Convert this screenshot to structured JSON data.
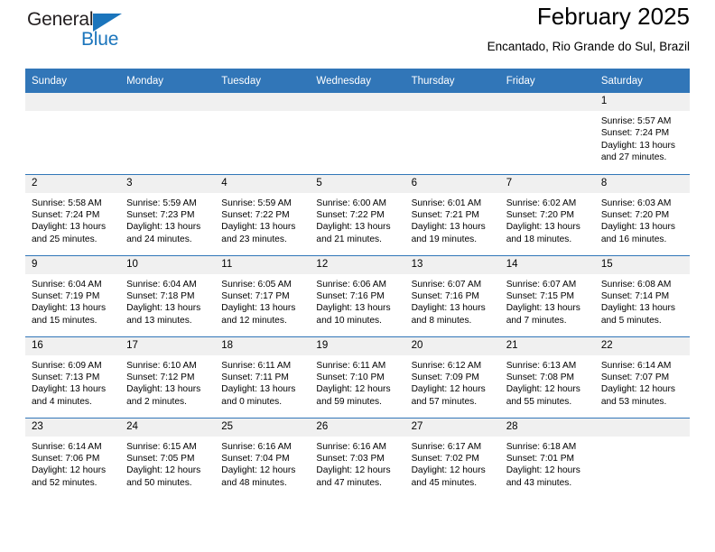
{
  "brand": {
    "name_part1": "General",
    "name_part2": "Blue",
    "triangle_icon": "triangle-icon",
    "accent_color": "#1b75bc"
  },
  "header": {
    "title": "February 2025",
    "subtitle": "Encantado, Rio Grande do Sul, Brazil",
    "header_bg_color": "#3176b8",
    "daynum_bg_color": "#f0f0f0"
  },
  "weekdays": [
    "Sunday",
    "Monday",
    "Tuesday",
    "Wednesday",
    "Thursday",
    "Friday",
    "Saturday"
  ],
  "weeks": [
    [
      {
        "day": "",
        "empty": true,
        "sunrise": "",
        "sunset": "",
        "daylight1": "",
        "daylight2": ""
      },
      {
        "day": "",
        "empty": true,
        "sunrise": "",
        "sunset": "",
        "daylight1": "",
        "daylight2": ""
      },
      {
        "day": "",
        "empty": true,
        "sunrise": "",
        "sunset": "",
        "daylight1": "",
        "daylight2": ""
      },
      {
        "day": "",
        "empty": true,
        "sunrise": "",
        "sunset": "",
        "daylight1": "",
        "daylight2": ""
      },
      {
        "day": "",
        "empty": true,
        "sunrise": "",
        "sunset": "",
        "daylight1": "",
        "daylight2": ""
      },
      {
        "day": "",
        "empty": true,
        "sunrise": "",
        "sunset": "",
        "daylight1": "",
        "daylight2": ""
      },
      {
        "day": "1",
        "empty": false,
        "sunrise": "Sunrise: 5:57 AM",
        "sunset": "Sunset: 7:24 PM",
        "daylight1": "Daylight: 13 hours",
        "daylight2": "and 27 minutes."
      }
    ],
    [
      {
        "day": "2",
        "empty": false,
        "sunrise": "Sunrise: 5:58 AM",
        "sunset": "Sunset: 7:24 PM",
        "daylight1": "Daylight: 13 hours",
        "daylight2": "and 25 minutes."
      },
      {
        "day": "3",
        "empty": false,
        "sunrise": "Sunrise: 5:59 AM",
        "sunset": "Sunset: 7:23 PM",
        "daylight1": "Daylight: 13 hours",
        "daylight2": "and 24 minutes."
      },
      {
        "day": "4",
        "empty": false,
        "sunrise": "Sunrise: 5:59 AM",
        "sunset": "Sunset: 7:22 PM",
        "daylight1": "Daylight: 13 hours",
        "daylight2": "and 23 minutes."
      },
      {
        "day": "5",
        "empty": false,
        "sunrise": "Sunrise: 6:00 AM",
        "sunset": "Sunset: 7:22 PM",
        "daylight1": "Daylight: 13 hours",
        "daylight2": "and 21 minutes."
      },
      {
        "day": "6",
        "empty": false,
        "sunrise": "Sunrise: 6:01 AM",
        "sunset": "Sunset: 7:21 PM",
        "daylight1": "Daylight: 13 hours",
        "daylight2": "and 19 minutes."
      },
      {
        "day": "7",
        "empty": false,
        "sunrise": "Sunrise: 6:02 AM",
        "sunset": "Sunset: 7:20 PM",
        "daylight1": "Daylight: 13 hours",
        "daylight2": "and 18 minutes."
      },
      {
        "day": "8",
        "empty": false,
        "sunrise": "Sunrise: 6:03 AM",
        "sunset": "Sunset: 7:20 PM",
        "daylight1": "Daylight: 13 hours",
        "daylight2": "and 16 minutes."
      }
    ],
    [
      {
        "day": "9",
        "empty": false,
        "sunrise": "Sunrise: 6:04 AM",
        "sunset": "Sunset: 7:19 PM",
        "daylight1": "Daylight: 13 hours",
        "daylight2": "and 15 minutes."
      },
      {
        "day": "10",
        "empty": false,
        "sunrise": "Sunrise: 6:04 AM",
        "sunset": "Sunset: 7:18 PM",
        "daylight1": "Daylight: 13 hours",
        "daylight2": "and 13 minutes."
      },
      {
        "day": "11",
        "empty": false,
        "sunrise": "Sunrise: 6:05 AM",
        "sunset": "Sunset: 7:17 PM",
        "daylight1": "Daylight: 13 hours",
        "daylight2": "and 12 minutes."
      },
      {
        "day": "12",
        "empty": false,
        "sunrise": "Sunrise: 6:06 AM",
        "sunset": "Sunset: 7:16 PM",
        "daylight1": "Daylight: 13 hours",
        "daylight2": "and 10 minutes."
      },
      {
        "day": "13",
        "empty": false,
        "sunrise": "Sunrise: 6:07 AM",
        "sunset": "Sunset: 7:16 PM",
        "daylight1": "Daylight: 13 hours",
        "daylight2": "and 8 minutes."
      },
      {
        "day": "14",
        "empty": false,
        "sunrise": "Sunrise: 6:07 AM",
        "sunset": "Sunset: 7:15 PM",
        "daylight1": "Daylight: 13 hours",
        "daylight2": "and 7 minutes."
      },
      {
        "day": "15",
        "empty": false,
        "sunrise": "Sunrise: 6:08 AM",
        "sunset": "Sunset: 7:14 PM",
        "daylight1": "Daylight: 13 hours",
        "daylight2": "and 5 minutes."
      }
    ],
    [
      {
        "day": "16",
        "empty": false,
        "sunrise": "Sunrise: 6:09 AM",
        "sunset": "Sunset: 7:13 PM",
        "daylight1": "Daylight: 13 hours",
        "daylight2": "and 4 minutes."
      },
      {
        "day": "17",
        "empty": false,
        "sunrise": "Sunrise: 6:10 AM",
        "sunset": "Sunset: 7:12 PM",
        "daylight1": "Daylight: 13 hours",
        "daylight2": "and 2 minutes."
      },
      {
        "day": "18",
        "empty": false,
        "sunrise": "Sunrise: 6:11 AM",
        "sunset": "Sunset: 7:11 PM",
        "daylight1": "Daylight: 13 hours",
        "daylight2": "and 0 minutes."
      },
      {
        "day": "19",
        "empty": false,
        "sunrise": "Sunrise: 6:11 AM",
        "sunset": "Sunset: 7:10 PM",
        "daylight1": "Daylight: 12 hours",
        "daylight2": "and 59 minutes."
      },
      {
        "day": "20",
        "empty": false,
        "sunrise": "Sunrise: 6:12 AM",
        "sunset": "Sunset: 7:09 PM",
        "daylight1": "Daylight: 12 hours",
        "daylight2": "and 57 minutes."
      },
      {
        "day": "21",
        "empty": false,
        "sunrise": "Sunrise: 6:13 AM",
        "sunset": "Sunset: 7:08 PM",
        "daylight1": "Daylight: 12 hours",
        "daylight2": "and 55 minutes."
      },
      {
        "day": "22",
        "empty": false,
        "sunrise": "Sunrise: 6:14 AM",
        "sunset": "Sunset: 7:07 PM",
        "daylight1": "Daylight: 12 hours",
        "daylight2": "and 53 minutes."
      }
    ],
    [
      {
        "day": "23",
        "empty": false,
        "sunrise": "Sunrise: 6:14 AM",
        "sunset": "Sunset: 7:06 PM",
        "daylight1": "Daylight: 12 hours",
        "daylight2": "and 52 minutes."
      },
      {
        "day": "24",
        "empty": false,
        "sunrise": "Sunrise: 6:15 AM",
        "sunset": "Sunset: 7:05 PM",
        "daylight1": "Daylight: 12 hours",
        "daylight2": "and 50 minutes."
      },
      {
        "day": "25",
        "empty": false,
        "sunrise": "Sunrise: 6:16 AM",
        "sunset": "Sunset: 7:04 PM",
        "daylight1": "Daylight: 12 hours",
        "daylight2": "and 48 minutes."
      },
      {
        "day": "26",
        "empty": false,
        "sunrise": "Sunrise: 6:16 AM",
        "sunset": "Sunset: 7:03 PM",
        "daylight1": "Daylight: 12 hours",
        "daylight2": "and 47 minutes."
      },
      {
        "day": "27",
        "empty": false,
        "sunrise": "Sunrise: 6:17 AM",
        "sunset": "Sunset: 7:02 PM",
        "daylight1": "Daylight: 12 hours",
        "daylight2": "and 45 minutes."
      },
      {
        "day": "28",
        "empty": false,
        "sunrise": "Sunrise: 6:18 AM",
        "sunset": "Sunset: 7:01 PM",
        "daylight1": "Daylight: 12 hours",
        "daylight2": "and 43 minutes."
      },
      {
        "day": "",
        "empty": true,
        "sunrise": "",
        "sunset": "",
        "daylight1": "",
        "daylight2": ""
      }
    ]
  ]
}
